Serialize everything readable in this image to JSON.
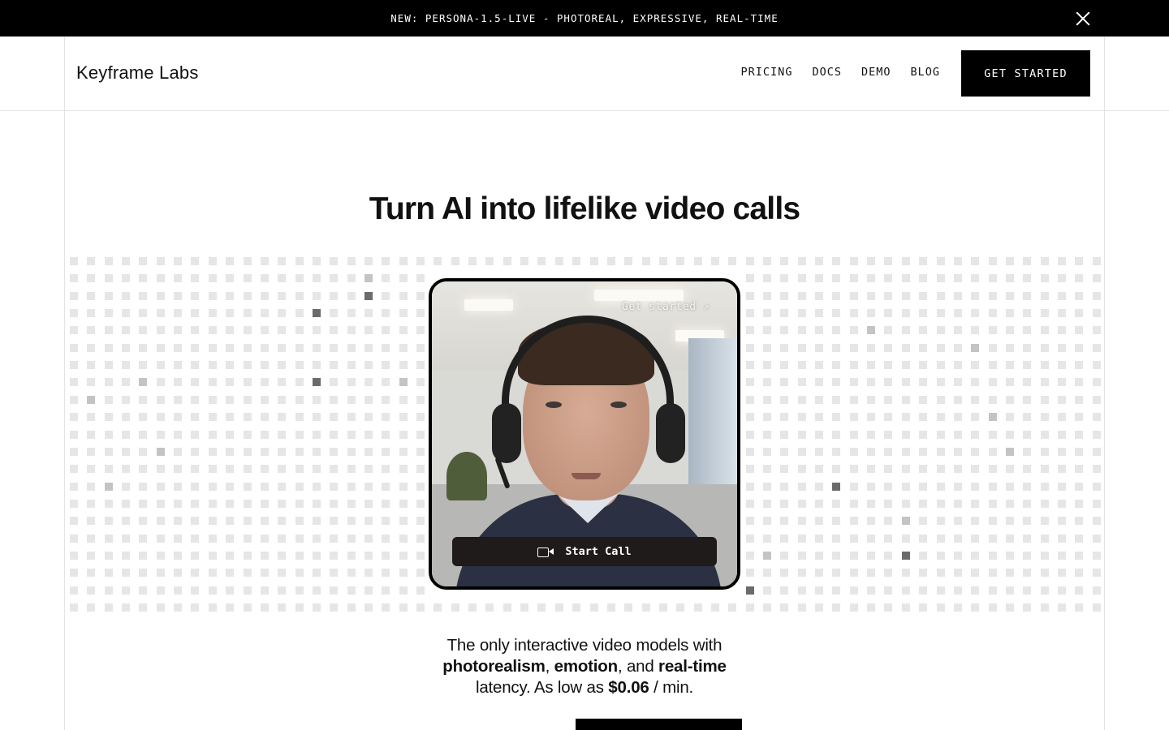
{
  "announcement": {
    "text": "NEW: PERSONA-1.5-LIVE - PHOTOREAL, EXPRESSIVE, REAL-TIME",
    "close_icon": "close-icon"
  },
  "header": {
    "brand": "Keyframe Labs",
    "nav": [
      "PRICING",
      "DOCS",
      "DEMO",
      "BLOG"
    ],
    "cta_label": "GET STARTED"
  },
  "hero": {
    "headline": "Turn AI into lifelike video calls",
    "video_card": {
      "link_label": "Get started ↗",
      "start_call_label": "Start Call",
      "start_call_icon": "video-camera-icon"
    },
    "subcopy": {
      "line1": "The only interactive video models with",
      "em1": "photorealism",
      "sep1": ", ",
      "em2": "emotion",
      "sep2": ", and ",
      "em3": "real-time",
      "line3_pre": "latency. As low as ",
      "price": "$0.06",
      "line3_post": " / min."
    }
  },
  "colors": {
    "accent": "#000000",
    "background": "#ffffff",
    "grid_light": "#e6e6e6",
    "grid_mid": "#c4c4c4",
    "grid_dark": "#6b6b6b"
  }
}
